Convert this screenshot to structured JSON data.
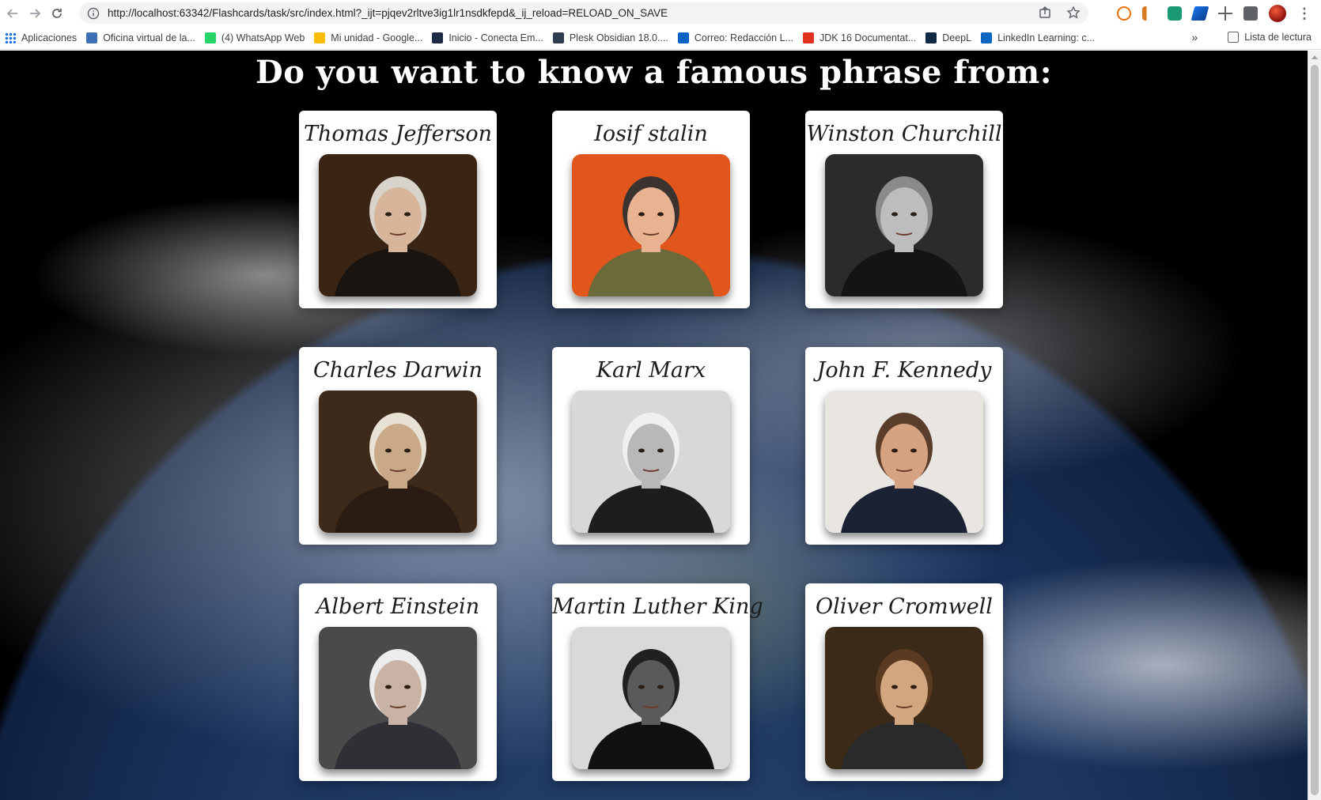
{
  "browser": {
    "url": "http://localhost:63342/Flashcards/task/src/index.html?_ijt=pjqev2rltve3ig1lr1nsdkfepd&_ij_reload=RELOAD_ON_SAVE",
    "nav_icons": [
      "back-arrow-icon",
      "forward-arrow-icon",
      "reload-icon",
      "info-icon"
    ],
    "omnibox_icons": [
      "share-icon",
      "star-icon"
    ],
    "extension_icons": [
      "extension-1-icon",
      "extension-2-icon",
      "extension-3-icon",
      "extension-4-icon",
      "extension-5-icon",
      "puzzle-icon"
    ],
    "bookmarks": [
      {
        "label": "Aplicaciones",
        "icon": "apps-grid-icon",
        "color": "#1a73e8"
      },
      {
        "label": "Oficina virtual de la...",
        "icon": "office-icon",
        "color": "#3b6fb6"
      },
      {
        "label": "(4) WhatsApp Web",
        "icon": "whatsapp-icon",
        "color": "#25d366"
      },
      {
        "label": "Mi unidad - Google...",
        "icon": "drive-icon",
        "color": "#fbbc04"
      },
      {
        "label": "Inicio - Conecta Em...",
        "icon": "ce-icon",
        "color": "#1f2a44"
      },
      {
        "label": "Plesk Obsidian 18.0....",
        "icon": "plesk-icon",
        "color": "#2c3e50"
      },
      {
        "label": "Correo: Redacción L...",
        "icon": "outlook-icon",
        "color": "#0a64c8"
      },
      {
        "label": "JDK 16 Documentat...",
        "icon": "oracle-icon",
        "color": "#e0301e"
      },
      {
        "label": "DeepL",
        "icon": "deepl-icon",
        "color": "#0f2b46"
      },
      {
        "label": "LinkedIn Learning: c...",
        "icon": "linkedin-icon",
        "color": "#0a66c2"
      }
    ],
    "more_bookmarks": "»",
    "reading_list": "Lista de lectura"
  },
  "page": {
    "heading": "Do you want to know a famous phrase from:",
    "cards": [
      {
        "name": "Thomas Jefferson",
        "bg": "#3a2414",
        "skin": "#d6b59a",
        "hair": "#d8d4cc",
        "coat": "#1a1410"
      },
      {
        "name": "Iosif stalin",
        "bg": "#e0561c",
        "skin": "#e9b392",
        "hair": "#3a3330",
        "coat": "#6b6a3a"
      },
      {
        "name": "Winston Churchill",
        "bg": "#2b2b2b",
        "skin": "#bdbdbd",
        "hair": "#8a8a8a",
        "coat": "#141414"
      },
      {
        "name": "Charles Darwin",
        "bg": "#3d2a1b",
        "skin": "#c9a987",
        "hair": "#e8e2d4",
        "coat": "#2a1c12"
      },
      {
        "name": "Karl Marx",
        "bg": "#d8d8d8",
        "skin": "#b8b8b8",
        "hair": "#f0f0f0",
        "coat": "#1d1d1d"
      },
      {
        "name": "John F. Kennedy",
        "bg": "#e9e6e2",
        "skin": "#d6a382",
        "hair": "#5a3e2b",
        "coat": "#1b2233"
      },
      {
        "name": "Albert Einstein",
        "bg": "#4a4a4a",
        "skin": "#c9b3a4",
        "hair": "#ececec",
        "coat": "#2f3036"
      },
      {
        "name": "Martin Luther King",
        "bg": "#d9d9d9",
        "skin": "#5a5a5a",
        "hair": "#202020",
        "coat": "#111111"
      },
      {
        "name": "Oliver Cromwell",
        "bg": "#3b2a17",
        "skin": "#d2a77f",
        "hair": "#5a3a20",
        "coat": "#2a2a2a"
      }
    ]
  }
}
